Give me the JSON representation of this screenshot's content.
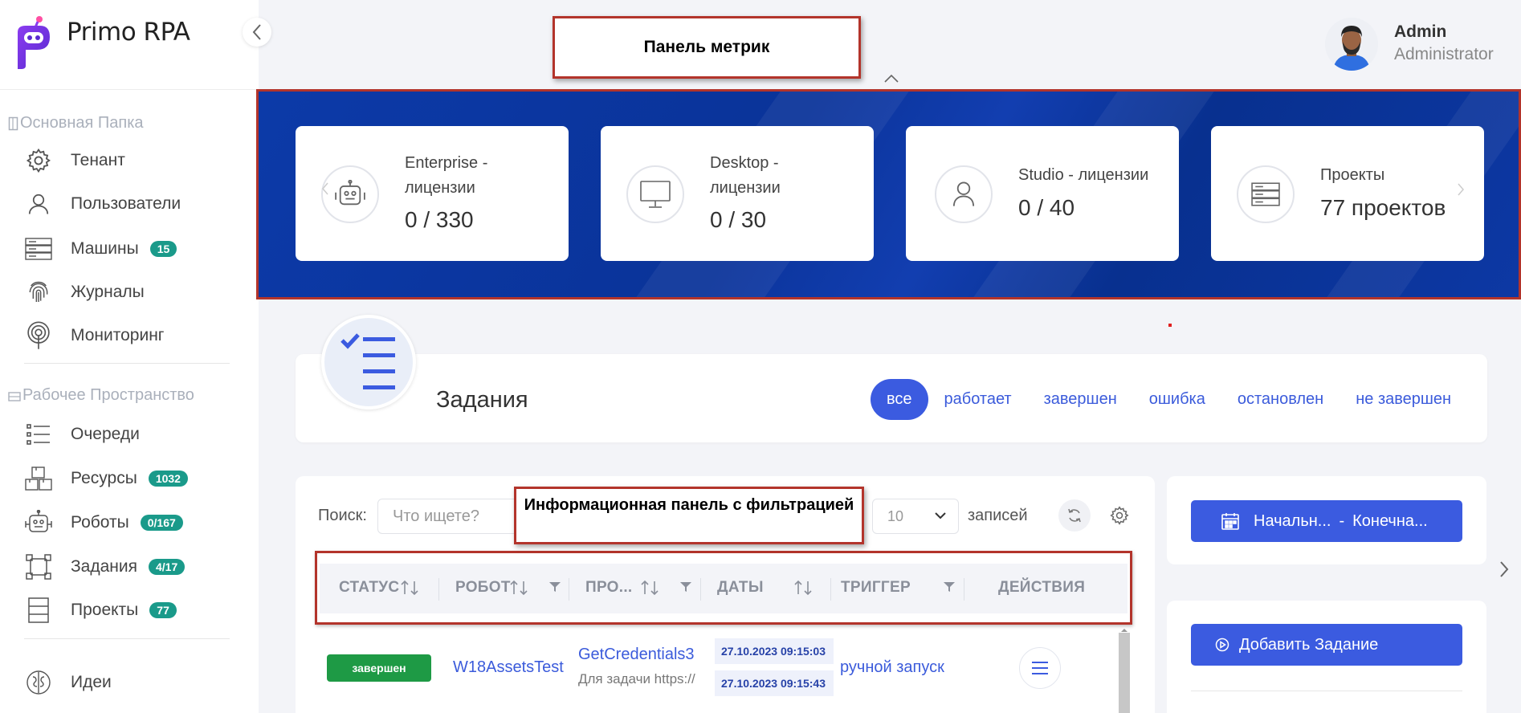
{
  "app": {
    "name": "Primo RPA"
  },
  "user": {
    "name": "Admin",
    "role": "Administrator"
  },
  "callouts": {
    "metrics": "Панель метрик",
    "info": "Информационная панель с фильтрацией"
  },
  "sidebar": {
    "sections": [
      {
        "title": "Основная Папка"
      },
      {
        "title": "Рабочее Пространство"
      }
    ],
    "main_items": [
      {
        "label": "Тенант",
        "icon": "gear-icon"
      },
      {
        "label": "Пользователи",
        "icon": "user-icon"
      },
      {
        "label": "Машины",
        "icon": "server-icon",
        "badge": "15"
      },
      {
        "label": "Журналы",
        "icon": "fingerprint-icon"
      },
      {
        "label": "Мониторинг",
        "icon": "broadcast-icon"
      }
    ],
    "workspace_items": [
      {
        "label": "Очереди",
        "icon": "list-icon"
      },
      {
        "label": "Ресурсы",
        "icon": "boxes-icon",
        "badge": "1032"
      },
      {
        "label": "Роботы",
        "icon": "robot-icon",
        "badge": "0/167"
      },
      {
        "label": "Задания",
        "icon": "tasks-icon",
        "badge": "4/17"
      },
      {
        "label": "Проекты",
        "icon": "projects-icon",
        "badge": "77"
      }
    ],
    "extra_items": [
      {
        "label": "Идеи",
        "icon": "brain-icon"
      }
    ]
  },
  "metrics": [
    {
      "title": "Enterprise - лицензии",
      "title_lines": [
        "Enterprise -",
        "лицензии"
      ],
      "value": "0 / 330",
      "icon": "robot-icon"
    },
    {
      "title": "Desktop - лицензии",
      "title_lines": [
        "Desktop -",
        "лицензии"
      ],
      "value": "0 / 30",
      "icon": "monitor-icon"
    },
    {
      "title": "Studio - лицензии",
      "title_lines": [
        "Studio - лицензии"
      ],
      "value": "0 / 40",
      "icon": "user-icon"
    },
    {
      "title": "Проекты",
      "title_lines": [
        "Проекты"
      ],
      "value": "77 проектов",
      "icon": "server-icon"
    }
  ],
  "tasks": {
    "title": "Задания",
    "filters": [
      "все",
      "работает",
      "завершен",
      "ошибка",
      "остановлен",
      "не завершен"
    ],
    "active_filter": "все"
  },
  "table": {
    "search_label": "Поиск:",
    "search_placeholder": "Что ищете?",
    "page_size": "10",
    "records_label": "записей",
    "columns": [
      "СТАТУС",
      "РОБОТ",
      "ПРО...",
      "ДАТЫ",
      "ТРИГГЕР",
      "ДЕЙСТВИЯ"
    ],
    "rows": [
      {
        "status": "завершен",
        "robot": "W18AssetsTest",
        "process": "GetCredentials3",
        "process_sub": "Для задачи https://",
        "date_start": "27.10.2023 09:15:03",
        "date_end": "27.10.2023 09:15:43",
        "trigger": "ручной запуск"
      }
    ]
  },
  "right_panel": {
    "date_start_label": "Начальн...",
    "date_sep": "-",
    "date_end_label": "Конечна...",
    "add_task_label": "Добавить Задание"
  },
  "colors": {
    "accent": "#3b5be0",
    "badge": "#1a9a8a",
    "status_done": "#1e9a45",
    "metrics_bg": "#0c3aa8",
    "callout_border": "#b3342b"
  }
}
